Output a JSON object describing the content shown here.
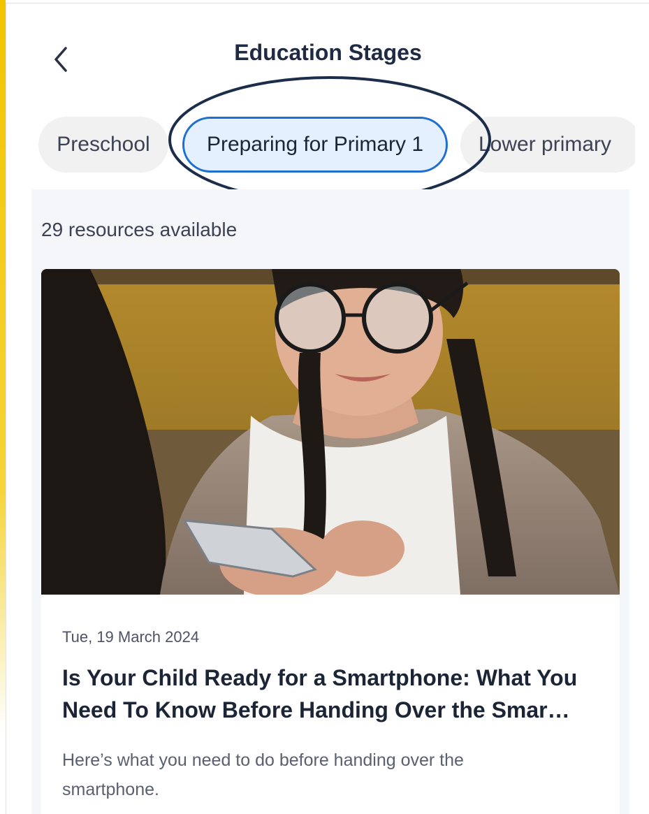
{
  "header": {
    "title": "Education Stages",
    "back_icon": "chevron-left-icon"
  },
  "tabs": [
    {
      "label": "Preschool",
      "active": false
    },
    {
      "label": "Preparing for Primary 1",
      "active": true
    },
    {
      "label": "Lower primary",
      "active": false
    }
  ],
  "annotation": {
    "shape": "ellipse",
    "color": "#1b2d4a"
  },
  "content": {
    "resource_count": "29 resources available"
  },
  "article": {
    "date": "Tue, 19 March 2024",
    "title": "Is Your Child Ready for a Smartphone: What You Need To Know Before Handing Over the Smar…",
    "summary": "Here’s what you need to do before handing over the smartphone.",
    "image": "girl-with-glasses-using-smartphone"
  },
  "colors": {
    "accent": "#1f6fd1",
    "active_tab_bg": "#e4f0fd",
    "title_text": "#1c2536",
    "content_bg": "#f4f6fa"
  }
}
